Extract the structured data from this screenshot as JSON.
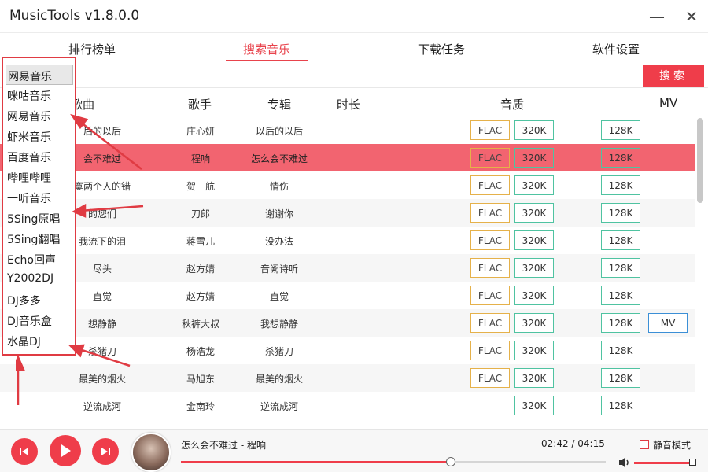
{
  "window": {
    "title": "MusicTools v1.8.0.0",
    "minimize": "—",
    "close": "✕"
  },
  "tabs": [
    {
      "label": "排行榜单"
    },
    {
      "label": "搜索音乐"
    },
    {
      "label": "下载任务"
    },
    {
      "label": "软件设置"
    }
  ],
  "search": {
    "value": "",
    "button": "搜索"
  },
  "columns": {
    "song": "歌曲",
    "artist": "歌手",
    "album": "专辑",
    "duration": "时长",
    "quality": "音质",
    "mv": "MV"
  },
  "quality_labels": {
    "flac": "FLAC",
    "k320": "320K",
    "k128": "128K",
    "mv": "MV"
  },
  "rows": [
    {
      "song": "后的以后",
      "artist": "庄心妍",
      "album": "以后的以后",
      "flac": true,
      "mv": false
    },
    {
      "song": "会不难过",
      "artist": "程响",
      "album": "怎么会不难过",
      "flac": true,
      "mv": false
    },
    {
      "song": "寞两个人的错",
      "artist": "贺一航",
      "album": "情伤",
      "flac": true,
      "mv": false
    },
    {
      "song": "的您们",
      "artist": "刀郎",
      "album": "谢谢你",
      "flac": true,
      "mv": false
    },
    {
      "song": "我流下的泪",
      "artist": "蒋雪儿",
      "album": "没办法",
      "flac": true,
      "mv": false
    },
    {
      "song": "尽头",
      "artist": "赵方婧",
      "album": "音阙诗听",
      "flac": true,
      "mv": false
    },
    {
      "song": "直觉",
      "artist": "赵方婧",
      "album": "直觉",
      "flac": true,
      "mv": false
    },
    {
      "song": "想静静",
      "artist": "秋裤大叔",
      "album": "我想静静",
      "flac": true,
      "mv": true
    },
    {
      "song": "杀猪刀",
      "artist": "杨浩龙",
      "album": "杀猪刀",
      "flac": true,
      "mv": false
    },
    {
      "song": "最美的烟火",
      "artist": "马旭东",
      "album": "最美的烟火",
      "flac": true,
      "mv": false
    },
    {
      "song": "逆流成河",
      "artist": "金南玲",
      "album": "逆流成河",
      "flac": false,
      "mv": false
    }
  ],
  "sources": [
    "网易音乐",
    "咪咕音乐",
    "网易音乐",
    "虾米音乐",
    "百度音乐",
    "哔哩哔哩",
    "一听音乐",
    "5Sing原唱",
    "5Sing翻唱",
    "Echo回声",
    "Y2002DJ",
    "DJ多多",
    "DJ音乐盒",
    "水晶DJ"
  ],
  "player": {
    "now_playing": "怎么会不难过 - 程响",
    "time": "02:42 / 04:15",
    "progress": 0.635,
    "mute_label": "静音模式",
    "volume": 1.0
  },
  "colors": {
    "accent": "#ef3d4a",
    "selected_row": "#f26470",
    "flac_border": "#e5b14a",
    "kbps_border": "#4fc3a1",
    "mv_border": "#3b8fd6"
  }
}
